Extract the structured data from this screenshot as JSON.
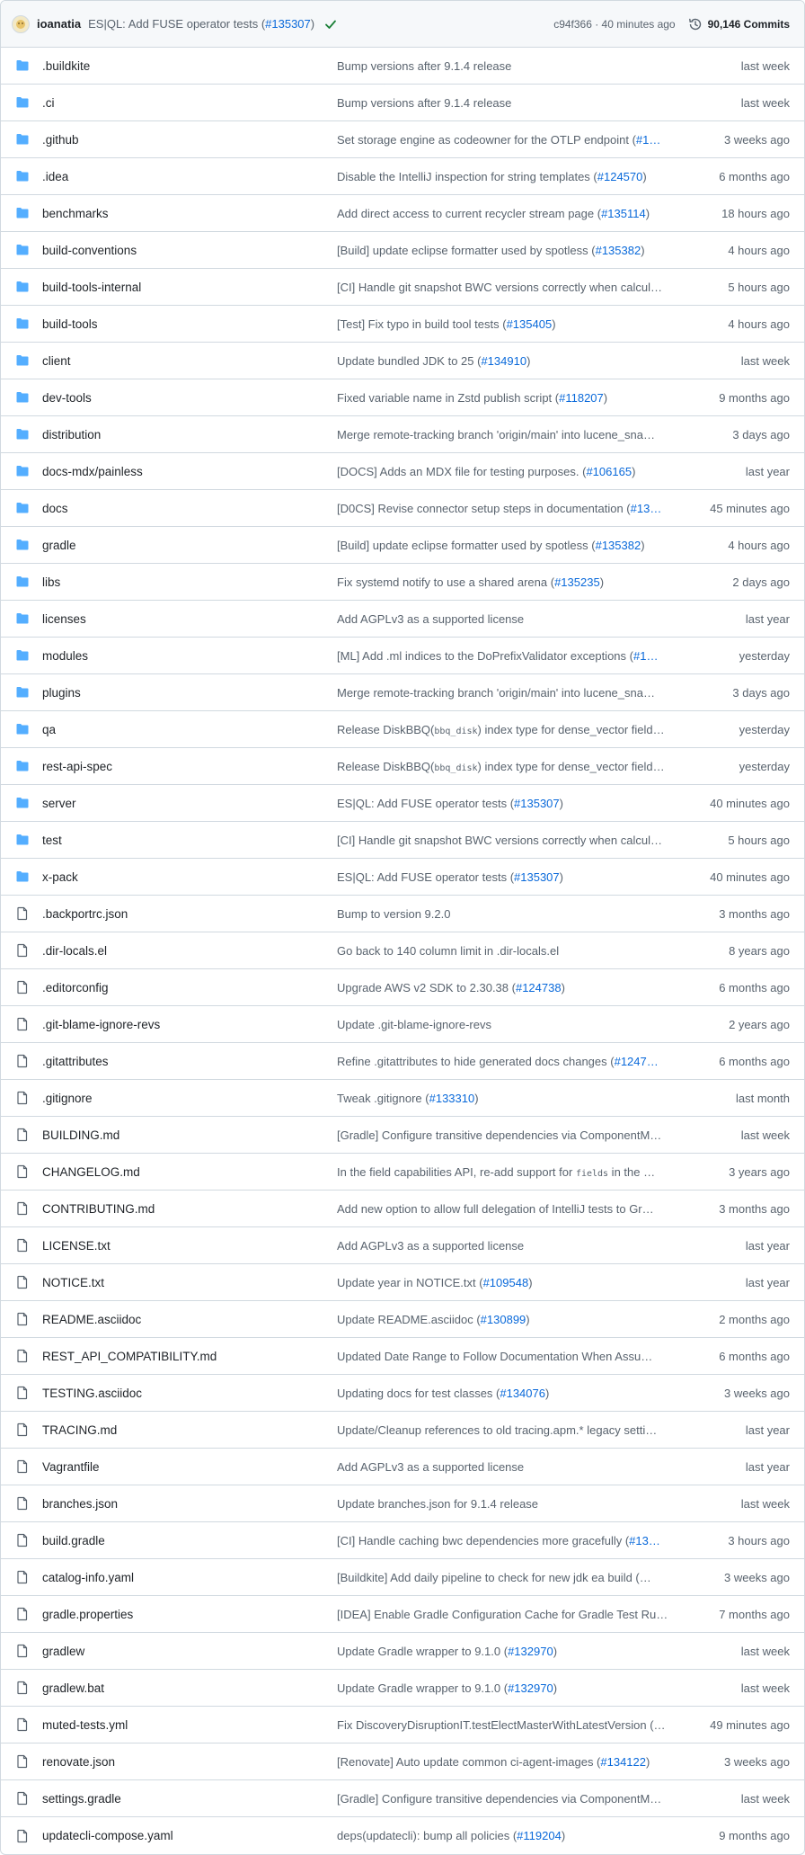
{
  "header": {
    "author": "ioanatia",
    "message_text": "ES|QL: Add FUSE operator tests (",
    "message_pr": "#135307",
    "message_end": ")",
    "commit_hash": "c94f366 · 40 minutes ago",
    "commits_label": "90,146 Commits"
  },
  "colors": {
    "folder": "#54aeff",
    "file_icon": "#59636e",
    "link": "#0969da",
    "check": "#1a7f37"
  },
  "rows": [
    {
      "type": "folder",
      "name": ".buildkite",
      "pre": "Bump versions after 9.1.4 release",
      "pr": "",
      "post": "",
      "age": "last week"
    },
    {
      "type": "folder",
      "name": ".ci",
      "pre": "Bump versions after 9.1.4 release",
      "pr": "",
      "post": "",
      "age": "last week"
    },
    {
      "type": "folder",
      "name": ".github",
      "pre": "Set storage engine as codeowner for the OTLP endpoint (",
      "pr": "#1…",
      "post": "",
      "age": "3 weeks ago"
    },
    {
      "type": "folder",
      "name": ".idea",
      "pre": "Disable the IntelliJ inspection for string templates (",
      "pr": "#124570",
      "post": ")",
      "age": "6 months ago"
    },
    {
      "type": "folder",
      "name": "benchmarks",
      "pre": "Add direct access to current recycler stream page (",
      "pr": "#135114",
      "post": ")",
      "age": "18 hours ago"
    },
    {
      "type": "folder",
      "name": "build-conventions",
      "pre": "[Build] update eclipse formatter used by spotless (",
      "pr": "#135382",
      "post": ")",
      "age": "4 hours ago"
    },
    {
      "type": "folder",
      "name": "build-tools-internal",
      "pre": "[CI] Handle git snapshot BWC versions correctly when calcul…",
      "pr": "",
      "post": "",
      "age": "5 hours ago"
    },
    {
      "type": "folder",
      "name": "build-tools",
      "pre": "[Test] Fix typo in build tool tests (",
      "pr": "#135405",
      "post": ")",
      "age": "4 hours ago"
    },
    {
      "type": "folder",
      "name": "client",
      "pre": "Update bundled JDK to 25 (",
      "pr": "#134910",
      "post": ")",
      "age": "last week"
    },
    {
      "type": "folder",
      "name": "dev-tools",
      "pre": "Fixed variable name in Zstd publish script (",
      "pr": "#118207",
      "post": ")",
      "age": "9 months ago"
    },
    {
      "type": "folder",
      "name": "distribution",
      "pre": "Merge remote-tracking branch 'origin/main' into lucene_sna…",
      "pr": "",
      "post": "",
      "age": "3 days ago"
    },
    {
      "type": "folder",
      "name": "docs-mdx/painless",
      "pre": "[DOCS] Adds an MDX file for testing purposes. (",
      "pr": "#106165",
      "post": ")",
      "age": "last year"
    },
    {
      "type": "folder",
      "name": "docs",
      "pre": "[D0CS] Revise connector setup steps in documentation (",
      "pr": "#13…",
      "post": "",
      "age": "45 minutes ago"
    },
    {
      "type": "folder",
      "name": "gradle",
      "pre": "[Build] update eclipse formatter used by spotless (",
      "pr": "#135382",
      "post": ")",
      "age": "4 hours ago"
    },
    {
      "type": "folder",
      "name": "libs",
      "pre": "Fix systemd notify to use a shared arena (",
      "pr": "#135235",
      "post": ")",
      "age": "2 days ago"
    },
    {
      "type": "folder",
      "name": "licenses",
      "pre": "Add AGPLv3 as a supported license",
      "pr": "",
      "post": "",
      "age": "last year"
    },
    {
      "type": "folder",
      "name": "modules",
      "pre": "[ML] Add .ml indices to the DoPrefixValidator exceptions (",
      "pr": "#1…",
      "post": "",
      "age": "yesterday"
    },
    {
      "type": "folder",
      "name": "plugins",
      "pre": "Merge remote-tracking branch 'origin/main' into lucene_sna…",
      "pr": "",
      "post": "",
      "age": "3 days ago"
    },
    {
      "type": "folder",
      "name": "qa",
      "pre": "Release DiskBBQ(",
      "code": "bbq_disk",
      "post2": ") index type for dense_vector field…",
      "pr": "",
      "post": "",
      "age": "yesterday"
    },
    {
      "type": "folder",
      "name": "rest-api-spec",
      "pre": "Release DiskBBQ(",
      "code": "bbq_disk",
      "post2": ") index type for dense_vector field…",
      "pr": "",
      "post": "",
      "age": "yesterday"
    },
    {
      "type": "folder",
      "name": "server",
      "pre": "ES|QL: Add FUSE operator tests (",
      "pr": "#135307",
      "post": ")",
      "age": "40 minutes ago"
    },
    {
      "type": "folder",
      "name": "test",
      "pre": "[CI] Handle git snapshot BWC versions correctly when calcul…",
      "pr": "",
      "post": "",
      "age": "5 hours ago"
    },
    {
      "type": "folder",
      "name": "x-pack",
      "pre": "ES|QL: Add FUSE operator tests (",
      "pr": "#135307",
      "post": ")",
      "age": "40 minutes ago"
    },
    {
      "type": "file",
      "name": ".backportrc.json",
      "pre": "Bump to version 9.2.0",
      "pr": "",
      "post": "",
      "age": "3 months ago"
    },
    {
      "type": "file",
      "name": ".dir-locals.el",
      "pre": "Go back to 140 column limit in .dir-locals.el",
      "pr": "",
      "post": "",
      "age": "8 years ago"
    },
    {
      "type": "file",
      "name": ".editorconfig",
      "pre": "Upgrade AWS v2 SDK to 2.30.38 (",
      "pr": "#124738",
      "post": ")",
      "age": "6 months ago"
    },
    {
      "type": "file",
      "name": ".git-blame-ignore-revs",
      "pre": "Update .git-blame-ignore-revs",
      "pr": "",
      "post": "",
      "age": "2 years ago"
    },
    {
      "type": "file",
      "name": ".gitattributes",
      "pre": "Refine .gitattributes to hide generated docs changes (",
      "pr": "#1247…",
      "post": "",
      "age": "6 months ago"
    },
    {
      "type": "file",
      "name": ".gitignore",
      "pre": "Tweak .gitignore (",
      "pr": "#133310",
      "post": ")",
      "age": "last month"
    },
    {
      "type": "file",
      "name": "BUILDING.md",
      "pre": "[Gradle] Configure transitive dependencies via ComponentM…",
      "pr": "",
      "post": "",
      "age": "last week"
    },
    {
      "type": "file",
      "name": "CHANGELOG.md",
      "pre": "In the field capabilities API, re-add support for ",
      "code": "fields",
      "post2": " in the …",
      "pr": "",
      "post": "",
      "age": "3 years ago"
    },
    {
      "type": "file",
      "name": "CONTRIBUTING.md",
      "pre": "Add new option to allow full delegation of IntelliJ tests to Gr…",
      "pr": "",
      "post": "",
      "age": "3 months ago"
    },
    {
      "type": "file",
      "name": "LICENSE.txt",
      "pre": "Add AGPLv3 as a supported license",
      "pr": "",
      "post": "",
      "age": "last year"
    },
    {
      "type": "file",
      "name": "NOTICE.txt",
      "pre": "Update year in NOTICE.txt (",
      "pr": "#109548",
      "post": ")",
      "age": "last year"
    },
    {
      "type": "file",
      "name": "README.asciidoc",
      "pre": "Update README.asciidoc (",
      "pr": "#130899",
      "post": ")",
      "age": "2 months ago"
    },
    {
      "type": "file",
      "name": "REST_API_COMPATIBILITY.md",
      "pre": "Updated Date Range to Follow Documentation When Assu…",
      "pr": "",
      "post": "",
      "age": "6 months ago"
    },
    {
      "type": "file",
      "name": "TESTING.asciidoc",
      "pre": "Updating docs for test classes (",
      "pr": "#134076",
      "post": ")",
      "age": "3 weeks ago"
    },
    {
      "type": "file",
      "name": "TRACING.md",
      "pre": "Update/Cleanup references to old tracing.apm.* legacy setti…",
      "pr": "",
      "post": "",
      "age": "last year"
    },
    {
      "type": "file",
      "name": "Vagrantfile",
      "pre": "Add AGPLv3 as a supported license",
      "pr": "",
      "post": "",
      "age": "last year"
    },
    {
      "type": "file",
      "name": "branches.json",
      "pre": "Update branches.json for 9.1.4 release",
      "pr": "",
      "post": "",
      "age": "last week"
    },
    {
      "type": "file",
      "name": "build.gradle",
      "pre": "[CI] Handle caching bwc dependencies more gracefully (",
      "pr": "#13…",
      "post": "",
      "age": "3 hours ago"
    },
    {
      "type": "file",
      "name": "catalog-info.yaml",
      "pre": "[Buildkite] Add daily pipeline to check for new jdk ea build (…",
      "pr": "",
      "post": "",
      "age": "3 weeks ago"
    },
    {
      "type": "file",
      "name": "gradle.properties",
      "pre": "[IDEA] Enable Gradle Configuration Cache for Gradle Test Ru…",
      "pr": "",
      "post": "",
      "age": "7 months ago"
    },
    {
      "type": "file",
      "name": "gradlew",
      "pre": "Update Gradle wrapper to 9.1.0 (",
      "pr": "#132970",
      "post": ")",
      "age": "last week"
    },
    {
      "type": "file",
      "name": "gradlew.bat",
      "pre": "Update Gradle wrapper to 9.1.0 (",
      "pr": "#132970",
      "post": ")",
      "age": "last week"
    },
    {
      "type": "file",
      "name": "muted-tests.yml",
      "pre": "Fix DiscoveryDisruptionIT.testElectMasterWithLatestVersion (…",
      "pr": "",
      "post": "",
      "age": "49 minutes ago"
    },
    {
      "type": "file",
      "name": "renovate.json",
      "pre": "[Renovate] Auto update common ci-agent-images (",
      "pr": "#134122",
      "post": ")",
      "age": "3 weeks ago"
    },
    {
      "type": "file",
      "name": "settings.gradle",
      "pre": "[Gradle] Configure transitive dependencies via ComponentM…",
      "pr": "",
      "post": "",
      "age": "last week"
    },
    {
      "type": "file",
      "name": "updatecli-compose.yaml",
      "pre": "deps(updatecli): bump all policies (",
      "pr": "#119204",
      "post": ")",
      "age": "9 months ago"
    }
  ]
}
